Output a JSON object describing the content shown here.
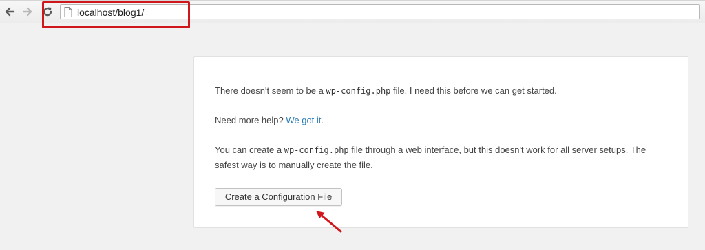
{
  "browser": {
    "url": "localhost/blog1/",
    "back_icon": "arrow-left-icon",
    "forward_icon": "arrow-right-icon",
    "reload_icon": "reload-icon",
    "page_icon": "document-icon"
  },
  "annotation": {
    "color": "#d0171c",
    "url_box": "highlight-rectangle",
    "button_pointer": "arrow-icon"
  },
  "setup": {
    "p1_before": "There doesn't seem to be a ",
    "p1_code": "wp-config.php",
    "p1_after": " file. I need this before we can get started.",
    "p2_before": "Need more help? ",
    "p2_link": "We got it.",
    "p3_before": "You can create a ",
    "p3_code": "wp-config.php",
    "p3_after": " file through a web interface, but this doesn't work for all server setups. The safest way is to manually create the file.",
    "button_label": "Create a Configuration File",
    "link_color": "#2a7bb5"
  }
}
